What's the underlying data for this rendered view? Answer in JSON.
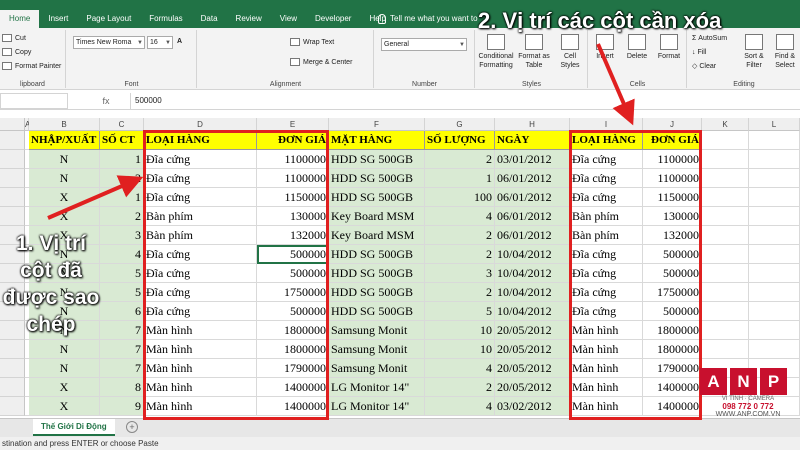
{
  "ribbon": {
    "tabs": [
      "Home",
      "Insert",
      "Page Layout",
      "Formulas",
      "Data",
      "Review",
      "View",
      "Developer",
      "Help",
      "Tell me what you want to"
    ],
    "active_tab": "Home",
    "clipboard": {
      "cut": "Cut",
      "copy": "Copy",
      "format_painter": "Format Painter",
      "label": "lipboard"
    },
    "font": {
      "name": "Times New Roma",
      "size": "16",
      "label": "Font"
    },
    "alignment": {
      "wrap_text": "Wrap Text",
      "merge_center": "Merge & Center",
      "label": "Alignment"
    },
    "number": {
      "format": "General",
      "label": "Number"
    },
    "styles": {
      "conditional_formatting": "Conditional Formatting",
      "format_as_table": "Format as Table",
      "cell_styles": "Cell Styles",
      "label": "Styles"
    },
    "cells": {
      "insert": "Insert",
      "delete": "Delete",
      "format": "Format",
      "label": "Cells"
    },
    "editing": {
      "autosum": "AutoSum",
      "fill": "Fill",
      "clear": "Clear",
      "sort_filter": "Sort & Filter",
      "find_select": "Find & Select",
      "label": "Editing"
    }
  },
  "formula_bar": {
    "fx": "fx",
    "value": "500000"
  },
  "columns": [
    "A",
    "B",
    "C",
    "D",
    "E",
    "F",
    "G",
    "H",
    "I",
    "J",
    "K",
    "L"
  ],
  "rows": [
    {
      "b": "NHẬP/XUẤT",
      "c": "SỐ CT",
      "d": "LOẠI HÀNG",
      "e": "ĐƠN GIÁ",
      "f": "MẶT HÀNG",
      "g": "SỐ LƯỢNG",
      "h": "NGÀY",
      "i": "LOẠI HÀNG",
      "j": "ĐƠN GIÁ"
    },
    {
      "b": "N",
      "c": "1",
      "d": "Đĩa cứng",
      "e": "1100000",
      "f": "HDD SG 500GB",
      "g": "2",
      "h": "03/01/2012",
      "i": "Đĩa cứng",
      "j": "1100000"
    },
    {
      "b": "N",
      "c": "2",
      "d": "Đĩa cứng",
      "e": "1100000",
      "f": "HDD SG 500GB",
      "g": "1",
      "h": "06/01/2012",
      "i": "Đĩa cứng",
      "j": "1100000"
    },
    {
      "b": "X",
      "c": "1",
      "d": "Đĩa cứng",
      "e": "1150000",
      "f": "HDD SG 500GB",
      "g": "100",
      "h": "06/01/2012",
      "i": "Đĩa cứng",
      "j": "1150000"
    },
    {
      "b": "X",
      "c": "2",
      "d": "Bàn phím",
      "e": "130000",
      "f": "Key Board MSM",
      "g": "4",
      "h": "06/01/2012",
      "i": "Bàn phím",
      "j": "130000"
    },
    {
      "b": "X",
      "c": "3",
      "d": "Bàn phím",
      "e": "132000",
      "f": "Key Board MSM",
      "g": "2",
      "h": "06/01/2012",
      "i": "Bàn phím",
      "j": "132000"
    },
    {
      "b": "N",
      "c": "4",
      "d": "Đĩa cứng",
      "e": "500000",
      "f": "HDD SG 500GB",
      "g": "2",
      "h": "10/04/2012",
      "i": "Đĩa cứng",
      "j": "500000"
    },
    {
      "b": "N",
      "c": "5",
      "d": "Đĩa cứng",
      "e": "500000",
      "f": "HDD SG 500GB",
      "g": "3",
      "h": "10/04/2012",
      "i": "Đĩa cứng",
      "j": "500000"
    },
    {
      "b": "N",
      "c": "5",
      "d": "Đĩa cứng",
      "e": "1750000",
      "f": "HDD SG 500GB",
      "g": "2",
      "h": "10/04/2012",
      "i": "Đĩa cứng",
      "j": "1750000"
    },
    {
      "b": "N",
      "c": "6",
      "d": "Đĩa cứng",
      "e": "500000",
      "f": "HDD SG 500GB",
      "g": "5",
      "h": "10/04/2012",
      "i": "Đĩa cứng",
      "j": "500000"
    },
    {
      "b": "N",
      "c": "7",
      "d": "Màn hình",
      "e": "1800000",
      "f": "Samsung Monit",
      "g": "10",
      "h": "20/05/2012",
      "i": "Màn hình",
      "j": "1800000"
    },
    {
      "b": "N",
      "c": "7",
      "d": "Màn hình",
      "e": "1800000",
      "f": "Samsung Monit",
      "g": "10",
      "h": "20/05/2012",
      "i": "Màn hình",
      "j": "1800000"
    },
    {
      "b": "N",
      "c": "7",
      "d": "Màn hình",
      "e": "1790000",
      "f": "Samsung Monit",
      "g": "4",
      "h": "20/05/2012",
      "i": "Màn hình",
      "j": "1790000"
    },
    {
      "b": "X",
      "c": "8",
      "d": "Màn hình",
      "e": "1400000",
      "f": "LG Monitor 14\"",
      "g": "2",
      "h": "20/05/2012",
      "i": "Màn hình",
      "j": "1400000"
    },
    {
      "b": "X",
      "c": "9",
      "d": "Màn hình",
      "e": "1400000",
      "f": "LG Monitor 14\"",
      "g": "4",
      "h": "03/02/2012",
      "i": "Màn hình",
      "j": "1400000"
    }
  ],
  "sheet_tab": "Thế Giới Di Động",
  "status": "stination and press ENTER or choose Paste",
  "annotations": {
    "top": "2. Vị trí các cột cần xóa",
    "left": "1. Vị trí cột đã được sao chép"
  },
  "watermark": {
    "letters": [
      "A",
      "N",
      "P"
    ],
    "sub": "VI TÍNH · CAMERA",
    "phone": "098 772 0 772",
    "url": "WWW.ANP.COM.VN"
  },
  "colors": {
    "excel_green": "#217346",
    "header_yellow": "#ffff00",
    "highlight_green": "#d9ead3",
    "annotation_red": "#e02020"
  }
}
